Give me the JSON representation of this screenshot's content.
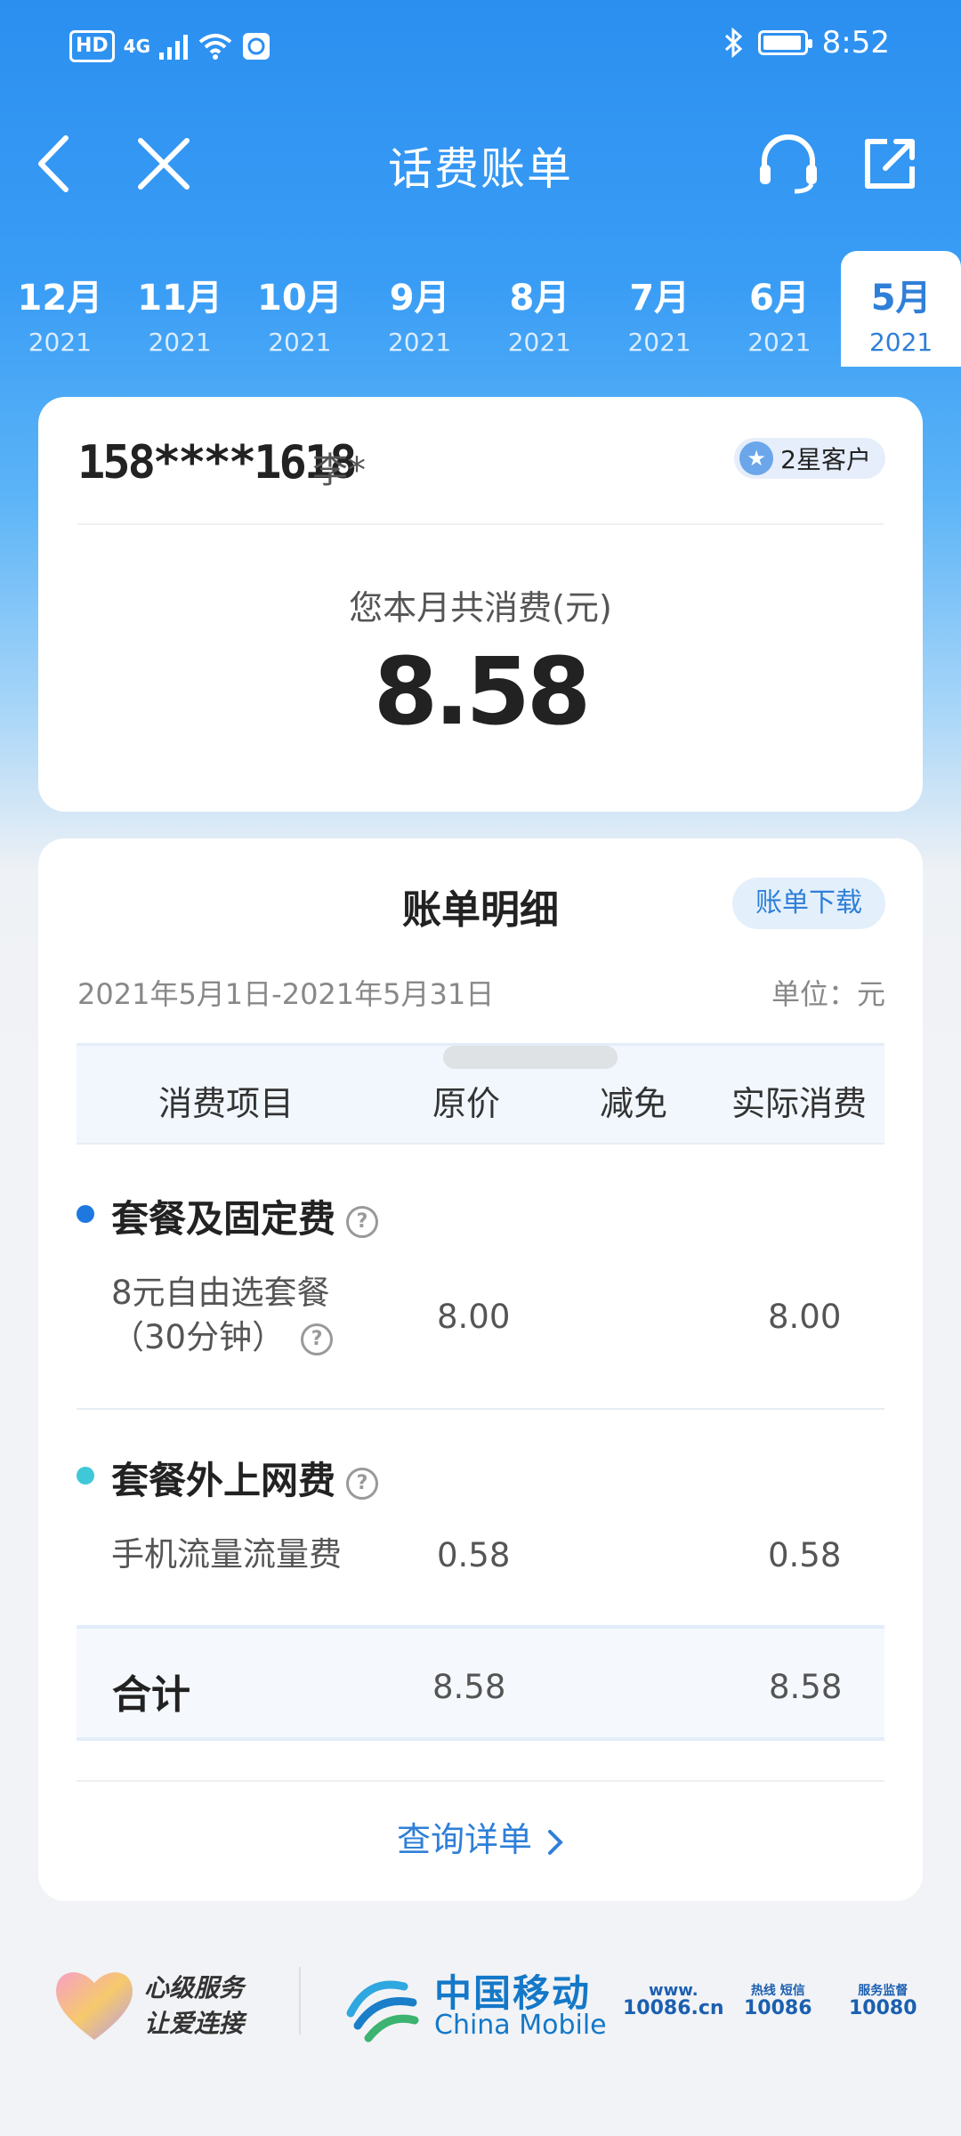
{
  "status_bar": {
    "hd": "HD",
    "network": "4G",
    "time": "8:52",
    "icons": [
      "signal-icon",
      "wifi-icon",
      "sim-icon",
      "bluetooth-icon",
      "battery-icon"
    ]
  },
  "nav": {
    "title": "话费账单",
    "icons": [
      "back-icon",
      "close-icon",
      "headset-icon",
      "share-icon"
    ]
  },
  "months": [
    {
      "month": "12月",
      "year": "2021"
    },
    {
      "month": "11月",
      "year": "2021"
    },
    {
      "month": "10月",
      "year": "2021"
    },
    {
      "month": "9月",
      "year": "2021"
    },
    {
      "month": "8月",
      "year": "2021"
    },
    {
      "month": "7月",
      "year": "2021"
    },
    {
      "month": "6月",
      "year": "2021"
    },
    {
      "month": "5月",
      "year": "2021"
    }
  ],
  "selected_month_index": 7,
  "account": {
    "phone": "158****1618",
    "name": "李*",
    "level": "2星客户",
    "total_label": "您本月共消费(元)",
    "total_value": "8.58"
  },
  "detail": {
    "title": "账单明细",
    "download_label": "账单下载",
    "period": "2021年5月1日-2021年5月31日",
    "unit": "单位：元",
    "columns": [
      "消费项目",
      "原价",
      "减免",
      "实际消费"
    ],
    "sections": [
      {
        "title": "套餐及固定费",
        "dot_color": "#1f78e0",
        "items": [
          {
            "name_line1": "8元自由选套餐",
            "name_line2": "（30分钟）",
            "original": "8.00",
            "discount": "",
            "actual": "8.00"
          }
        ]
      },
      {
        "title": "套餐外上网费",
        "dot_color": "#3fc8d8",
        "items": [
          {
            "name_line1": "手机流量流量费",
            "name_line2": "",
            "original": "0.58",
            "discount": "",
            "actual": "0.58"
          }
        ]
      }
    ],
    "total_row": {
      "label": "合计",
      "original": "8.58",
      "actual": "8.58"
    },
    "query_link": "查询详单"
  },
  "footer": {
    "slogan_line1": "心级服务",
    "slogan_line2": "让爱连接",
    "brand_cn": "中国移动",
    "brand_en": "China Mobile",
    "services": [
      {
        "top": "www.",
        "bottom": "10086.cn"
      },
      {
        "top": "热线 短信",
        "bottom": "10086"
      },
      {
        "top": "服务监督",
        "bottom": "10080"
      }
    ]
  },
  "colors": {
    "primary": "#2b8ff0",
    "link": "#2f7fd8",
    "brand": "#1478c8"
  }
}
